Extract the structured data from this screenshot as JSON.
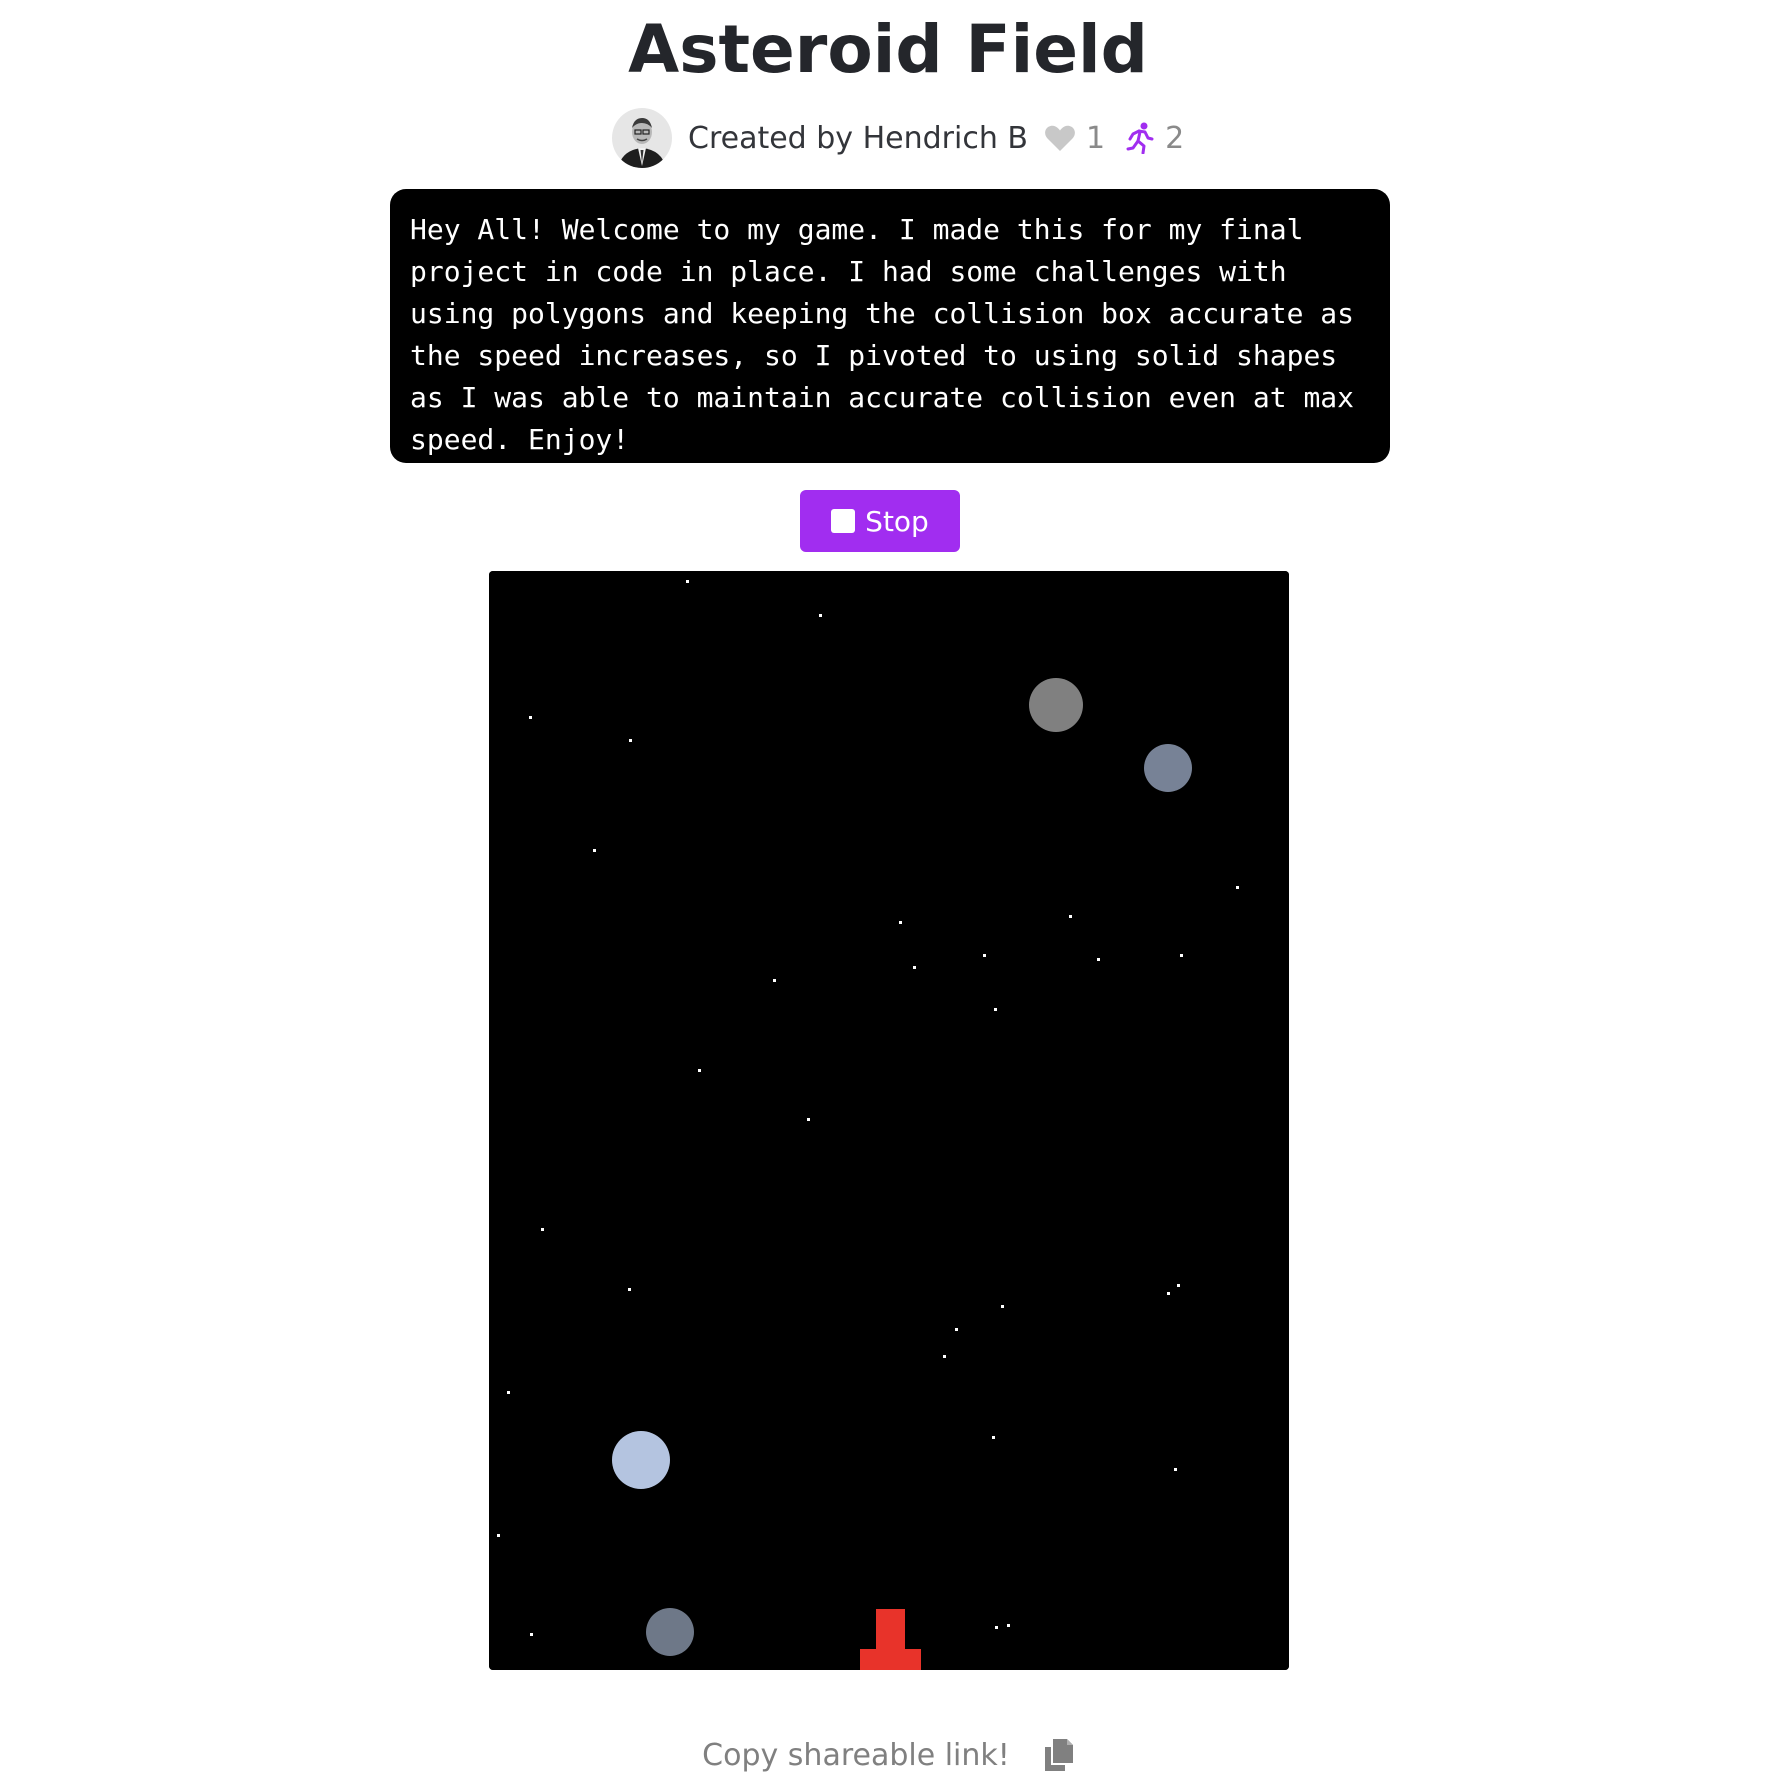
{
  "header": {
    "title": "Asteroid Field",
    "created_by": "Created by Hendrich B",
    "likes": "1",
    "runs": "2"
  },
  "description": "Hey All! Welcome to my game. I made this for my final project in code in place. I had some challenges with using polygons and keeping the collision box accurate as the speed increases, so I pivoted to using solid shapes as I was able to maintain accurate collision even at max speed. Enjoy!",
  "controls": {
    "stop_label": "Stop",
    "stop_color": "#a12df0"
  },
  "game": {
    "background": "#000000",
    "player_color": "#e8332a",
    "asteroid_colors": [
      "#808080",
      "#778296",
      "#b4c4e0",
      "#6e7888"
    ]
  },
  "footer": {
    "share_label": "Copy shareable link!"
  },
  "icons": {
    "like": "heart-icon",
    "runs": "running-person-icon",
    "share": "copy-icon",
    "stop": "stop-square-icon"
  }
}
